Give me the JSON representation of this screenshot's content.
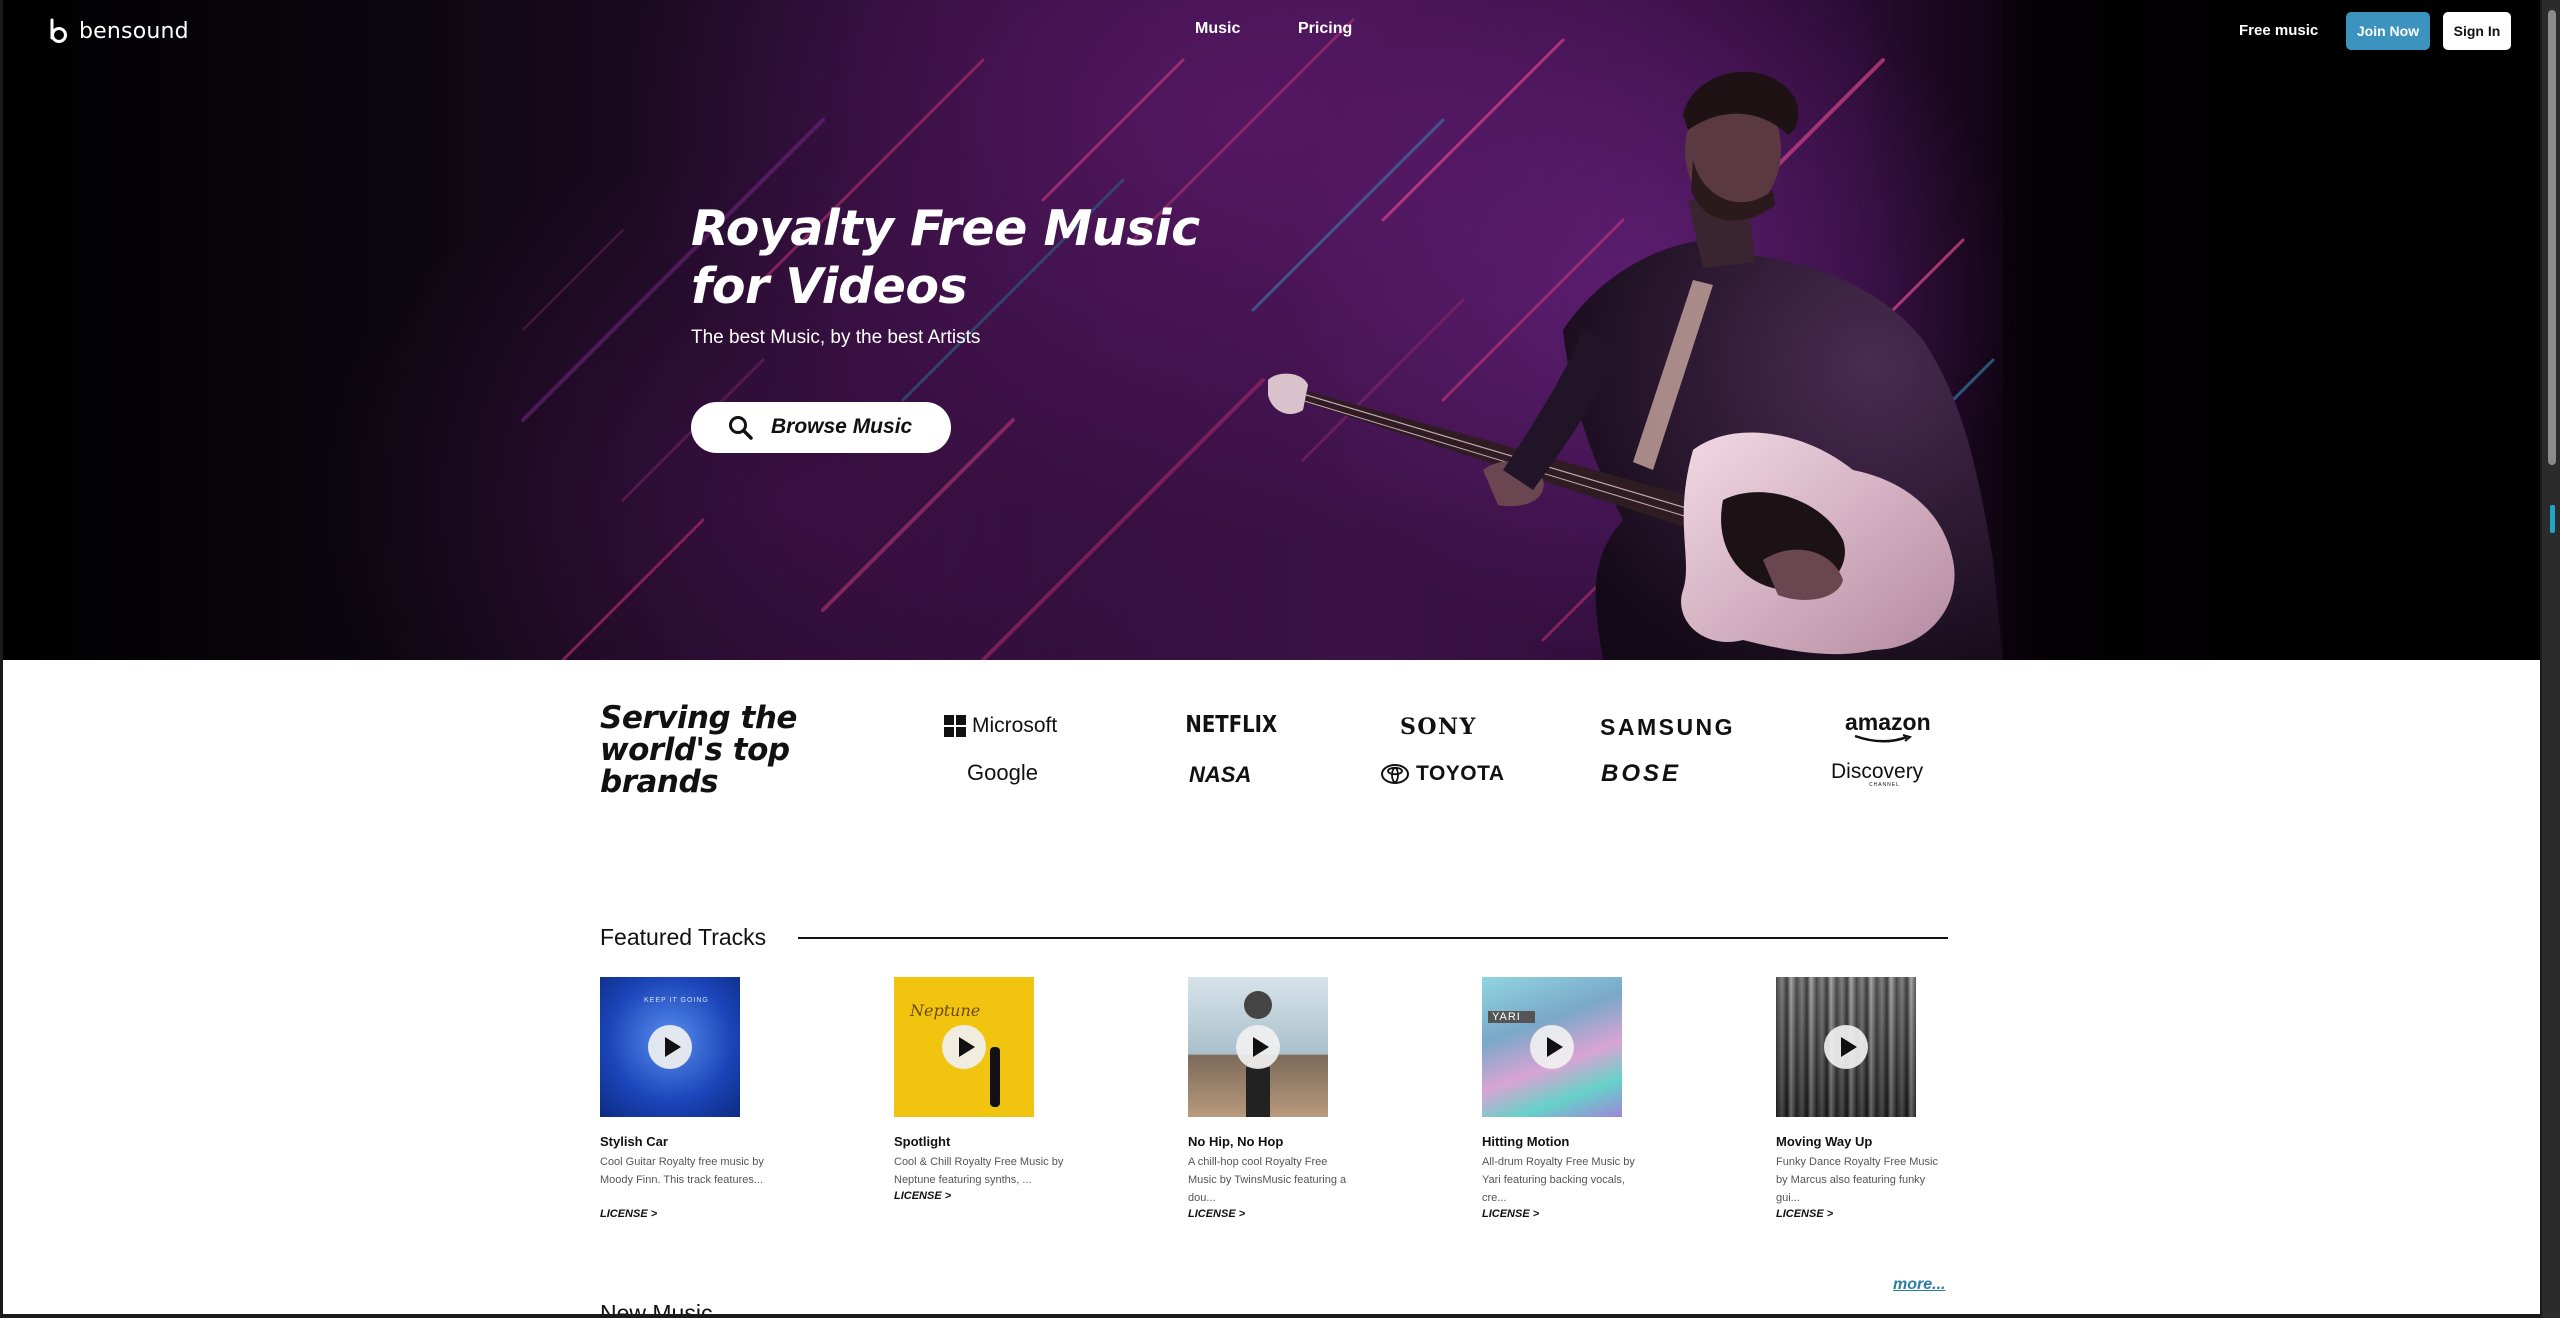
{
  "header": {
    "logo_text": "bensound",
    "nav": {
      "music": "Music",
      "pricing": "Pricing"
    },
    "free_music": "Free music",
    "join_now": "Join Now",
    "sign_in": "Sign In"
  },
  "hero": {
    "title_line1": "Royalty Free Music",
    "title_line2": "for Videos",
    "subtitle": "The best Music, by the best Artists",
    "browse_label": "Browse Music"
  },
  "brands": {
    "title_line1": "Serving the",
    "title_line2": "world's top",
    "title_line3": "brands",
    "logos": [
      "Microsoft",
      "NETFLIX",
      "SONY",
      "SAMSUNG",
      "amazon",
      "Google",
      "NASA",
      "TOYOTA",
      "BOSE",
      "Discovery"
    ],
    "discovery_sub": "CHANNEL"
  },
  "featured": {
    "title": "Featured Tracks",
    "tracks": [
      {
        "title": "Stylish Car",
        "desc": "Cool Guitar Royalty free music by Moody Finn. This track features...",
        "license": "LICENSE >",
        "cover_text": "KEEP IT GOING"
      },
      {
        "title": "Spotlight",
        "desc": "Cool & Chill Royalty Free Music by Neptune featuring synths, ...",
        "license": "LICENSE >",
        "cover_text": "Neptune"
      },
      {
        "title": "No Hip, No Hop",
        "desc": "A chill-hop cool Royalty Free Music by TwinsMusic featuring a dou...",
        "license": "LICENSE >",
        "cover_text": ""
      },
      {
        "title": "Hitting Motion",
        "desc": "All-drum Royalty Free Music by Yari featuring backing vocals, cre...",
        "license": "LICENSE >",
        "cover_text": "YARI"
      },
      {
        "title": "Moving Way Up",
        "desc": "Funky Dance Royalty Free Music by Marcus also featuring funky gui...",
        "license": "LICENSE >",
        "cover_text": ""
      }
    ],
    "more": "more..."
  },
  "new_music": {
    "title": "New Music"
  },
  "colors": {
    "accent": "#3c93bd",
    "link": "#2c7ea7",
    "hero_purple": "#3b1246"
  },
  "icons": {
    "search": "search-icon",
    "play": "play-icon",
    "logo": "bensound-logo-icon"
  }
}
